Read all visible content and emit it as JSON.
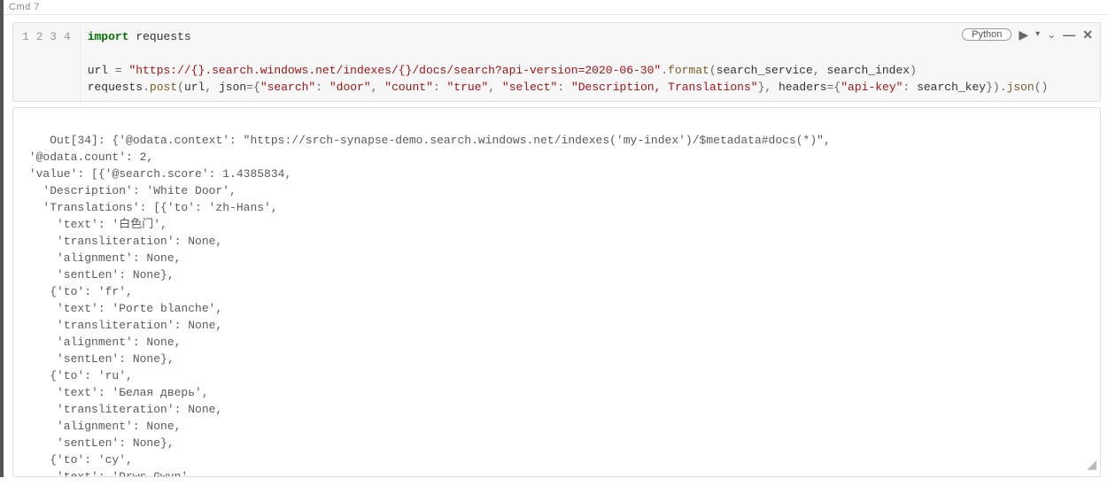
{
  "cell": {
    "label": "Cmd 7"
  },
  "toolbar": {
    "lang": "Python"
  },
  "gutter": [
    "1",
    "2",
    "3",
    "4"
  ],
  "code": {
    "l1": {
      "kw_import": "import",
      "mod": "requests"
    },
    "l2": "",
    "l3": {
      "lhs": "url",
      "eq": " = ",
      "str": "\"https://{}.search.windows.net/indexes/{}/docs/search?api-version=2020-06-30\"",
      "dot": ".",
      "fmt": "format",
      "open": "(",
      "a1": "search_service",
      "comma": ", ",
      "a2": "search_index",
      "close": ")"
    },
    "l4": {
      "mod": "requests",
      "dot1": ".",
      "post": "post",
      "open": "(",
      "url": "url",
      "c1": ", ",
      "kw_json": "json",
      "eq1": "=",
      "brace1": "{",
      "k_search": "\"search\"",
      "colon1": ": ",
      "v_search": "\"door\"",
      "c2": ", ",
      "k_count": "\"count\"",
      "colon2": ": ",
      "v_count": "\"true\"",
      "c3": ", ",
      "k_select": "\"select\"",
      "colon3": ": ",
      "v_select": "\"Description, Translations\"",
      "brace1c": "}",
      "c4": ", ",
      "kw_headers": "headers",
      "eq2": "=",
      "brace2": "{",
      "k_api": "\"api-key\"",
      "colon4": ": ",
      "v_api": "search_key",
      "brace2c": "}",
      "close": ")",
      "dot2": ".",
      "json": "json",
      "call": "()"
    }
  },
  "output": "Out[34]: {'@odata.context': \"https://srch-synapse-demo.search.windows.net/indexes('my-index')/$metadata#docs(*)\",\n '@odata.count': 2,\n 'value': [{'@search.score': 1.4385834,\n   'Description': 'White Door',\n   'Translations': [{'to': 'zh-Hans',\n     'text': '白色门',\n     'transliteration': None,\n     'alignment': None,\n     'sentLen': None},\n    {'to': 'fr',\n     'text': 'Porte blanche',\n     'transliteration': None,\n     'alignment': None,\n     'sentLen': None},\n    {'to': 'ru',\n     'text': 'Белая дверь',\n     'transliteration': None,\n     'alignment': None,\n     'sentLen': None},\n    {'to': 'cy',\n     'text': 'Drws Gwyn',"
}
